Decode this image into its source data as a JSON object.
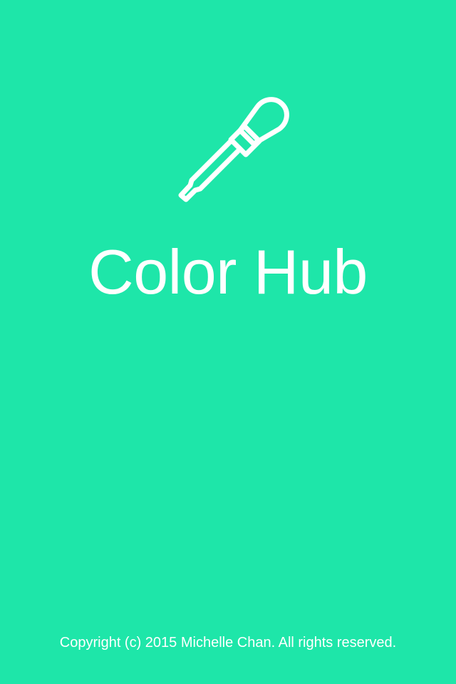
{
  "app": {
    "title": "Color Hub",
    "logo_icon": "eyedropper-icon",
    "background_color": "#1ee6a9",
    "foreground_color": "#ffffff"
  },
  "footer": {
    "copyright": "Copyright (c) 2015 Michelle Chan. All rights reserved."
  }
}
